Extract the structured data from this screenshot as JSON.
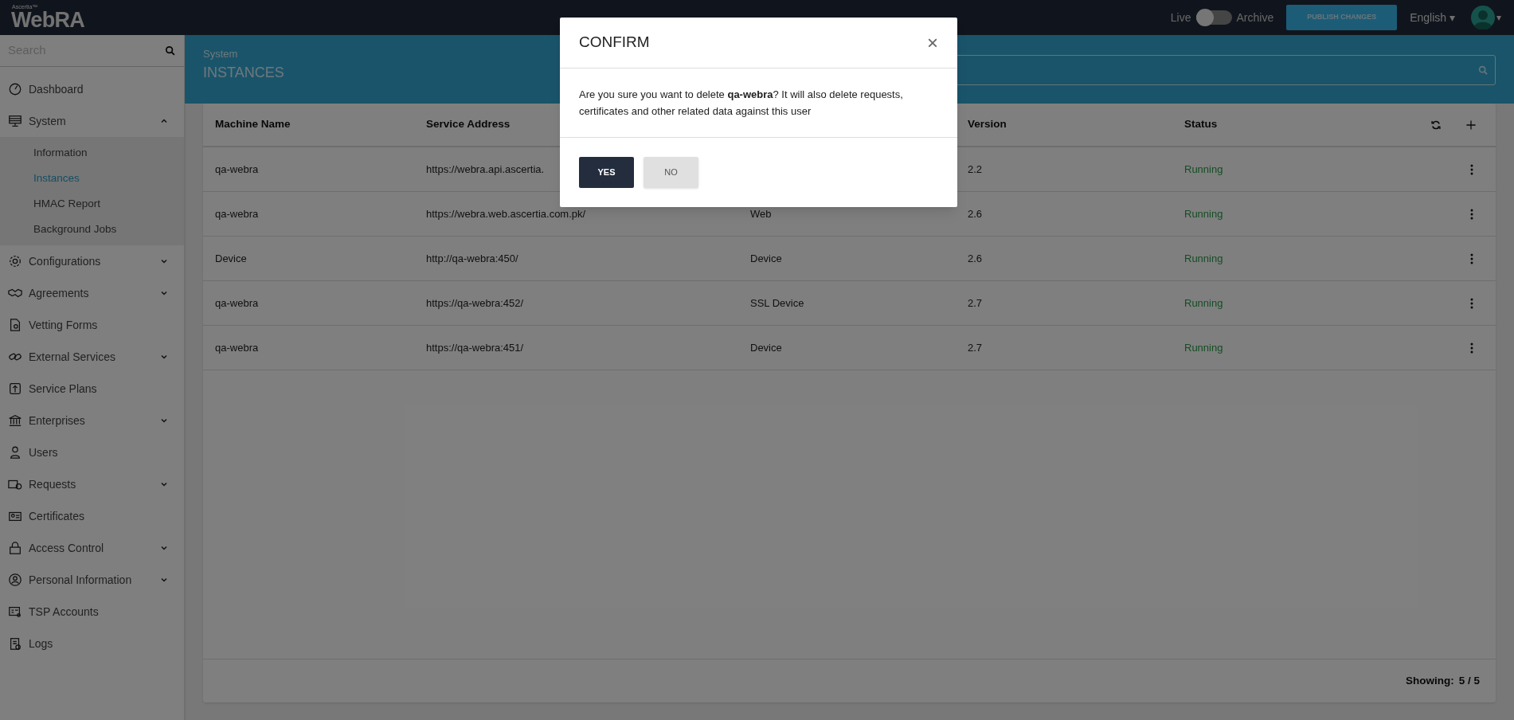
{
  "header": {
    "brand": "Ascertia™",
    "product": "WebRA",
    "toggle": {
      "left_label": "Live",
      "right_label": "Archive",
      "on": false
    },
    "publish_button": "PUBLISH CHANGES",
    "language": "English ▾",
    "avatar_caret": "▾"
  },
  "sidebar": {
    "search": {
      "placeholder": "Search"
    },
    "items": [
      {
        "label": "Dashboard",
        "kind": "link"
      },
      {
        "label": "System",
        "kind": "group",
        "expanded": true,
        "children": [
          {
            "label": "Information",
            "selected": false
          },
          {
            "label": "Instances",
            "selected": true
          },
          {
            "label": "HMAC Report",
            "selected": false
          },
          {
            "label": "Background Jobs",
            "selected": false
          }
        ]
      },
      {
        "label": "Configurations",
        "kind": "group",
        "expanded": false
      },
      {
        "label": "Agreements",
        "kind": "group",
        "expanded": false
      },
      {
        "label": "Vetting Forms",
        "kind": "link"
      },
      {
        "label": "External Services",
        "kind": "group",
        "expanded": false
      },
      {
        "label": "Service Plans",
        "kind": "link"
      },
      {
        "label": "Enterprises",
        "kind": "group",
        "expanded": false
      },
      {
        "label": "Users",
        "kind": "link"
      },
      {
        "label": "Requests",
        "kind": "group",
        "expanded": false
      },
      {
        "label": "Certificates",
        "kind": "link"
      },
      {
        "label": "Access Control",
        "kind": "group",
        "expanded": false
      },
      {
        "label": "Personal Information",
        "kind": "group",
        "expanded": false
      },
      {
        "label": "TSP Accounts",
        "kind": "link"
      },
      {
        "label": "Logs",
        "kind": "link"
      }
    ]
  },
  "page": {
    "breadcrumb": "System",
    "title": "INSTANCES"
  },
  "table": {
    "columns": {
      "machine_name": "Machine Name",
      "service_address": "Service Address",
      "version": "Version",
      "status": "Status"
    },
    "rows": [
      {
        "machine_name": "qa-webra",
        "service_address": "https://webra.api.ascertia.",
        "version": "2.2",
        "status": "Running"
      },
      {
        "machine_name": "qa-webra",
        "service_address": "https://webra.web.ascertia.com.pk/",
        "column_3": "Web",
        "version": "2.6",
        "status": "Running"
      },
      {
        "machine_name": "Device",
        "service_address": "http://qa-webra:450/",
        "column_3": "Device",
        "version": "2.6",
        "status": "Running"
      },
      {
        "machine_name": "qa-webra",
        "service_address": "https://qa-webra:452/",
        "column_3": "SSL Device",
        "version": "2.7",
        "status": "Running"
      },
      {
        "machine_name": "qa-webra",
        "service_address": "https://qa-webra:451/",
        "column_3": "Device",
        "version": "2.7",
        "status": "Running"
      }
    ],
    "footer": {
      "label": "Showing:",
      "count": "5 / 5"
    }
  },
  "dialog": {
    "title": "CONFIRM",
    "close": "×",
    "message": "Are you sure you want to delete **qa-webra**? It will also delete requests, certificates and other related data against this user",
    "buttons": [
      {
        "label": "YES",
        "kind": "primary"
      },
      {
        "label": "NO",
        "kind": "secondary"
      }
    ]
  }
}
